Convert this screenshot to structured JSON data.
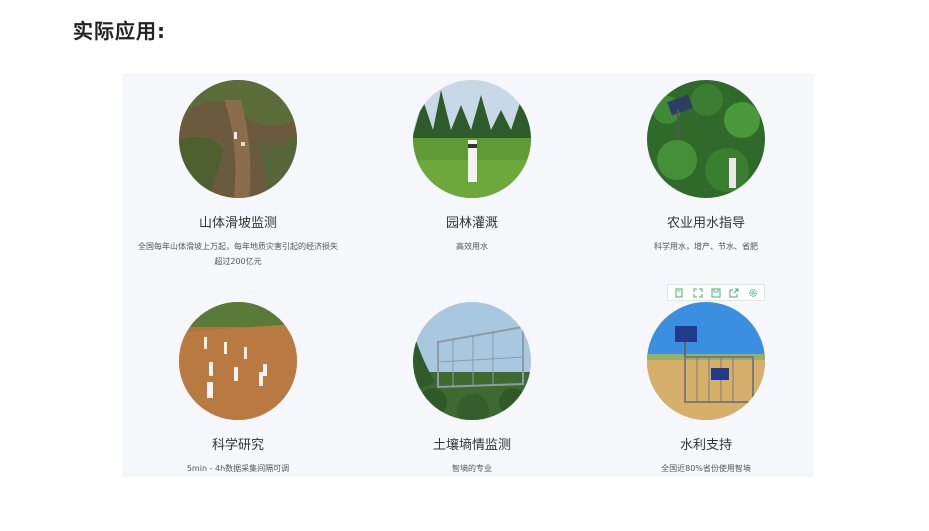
{
  "page": {
    "title": "实际应用:"
  },
  "cards": [
    {
      "title": "山体滑坡监测",
      "desc": "全国每年山体滑坡上万起，每年地质灾害引起的经济损失超过200亿元"
    },
    {
      "title": "园林灌溉",
      "desc": "高效用水"
    },
    {
      "title": "农业用水指导",
      "desc": "科学用水，增产、节水、省肥"
    },
    {
      "title": "科学研究",
      "desc": "5min - 4h数据采集间隔可调"
    },
    {
      "title": "土壤墒情监测",
      "desc": "智墒的专业"
    },
    {
      "title": "水利支持",
      "desc": "全国近80%省份使用智墒"
    }
  ],
  "toolbar": {
    "icons": [
      "bookmark-icon",
      "fullscreen-icon",
      "save-icon",
      "share-icon",
      "settings-icon"
    ],
    "accent": "#3cb371"
  },
  "colors": {
    "panel_bg": "#f6f7fb",
    "title": "#222222"
  }
}
